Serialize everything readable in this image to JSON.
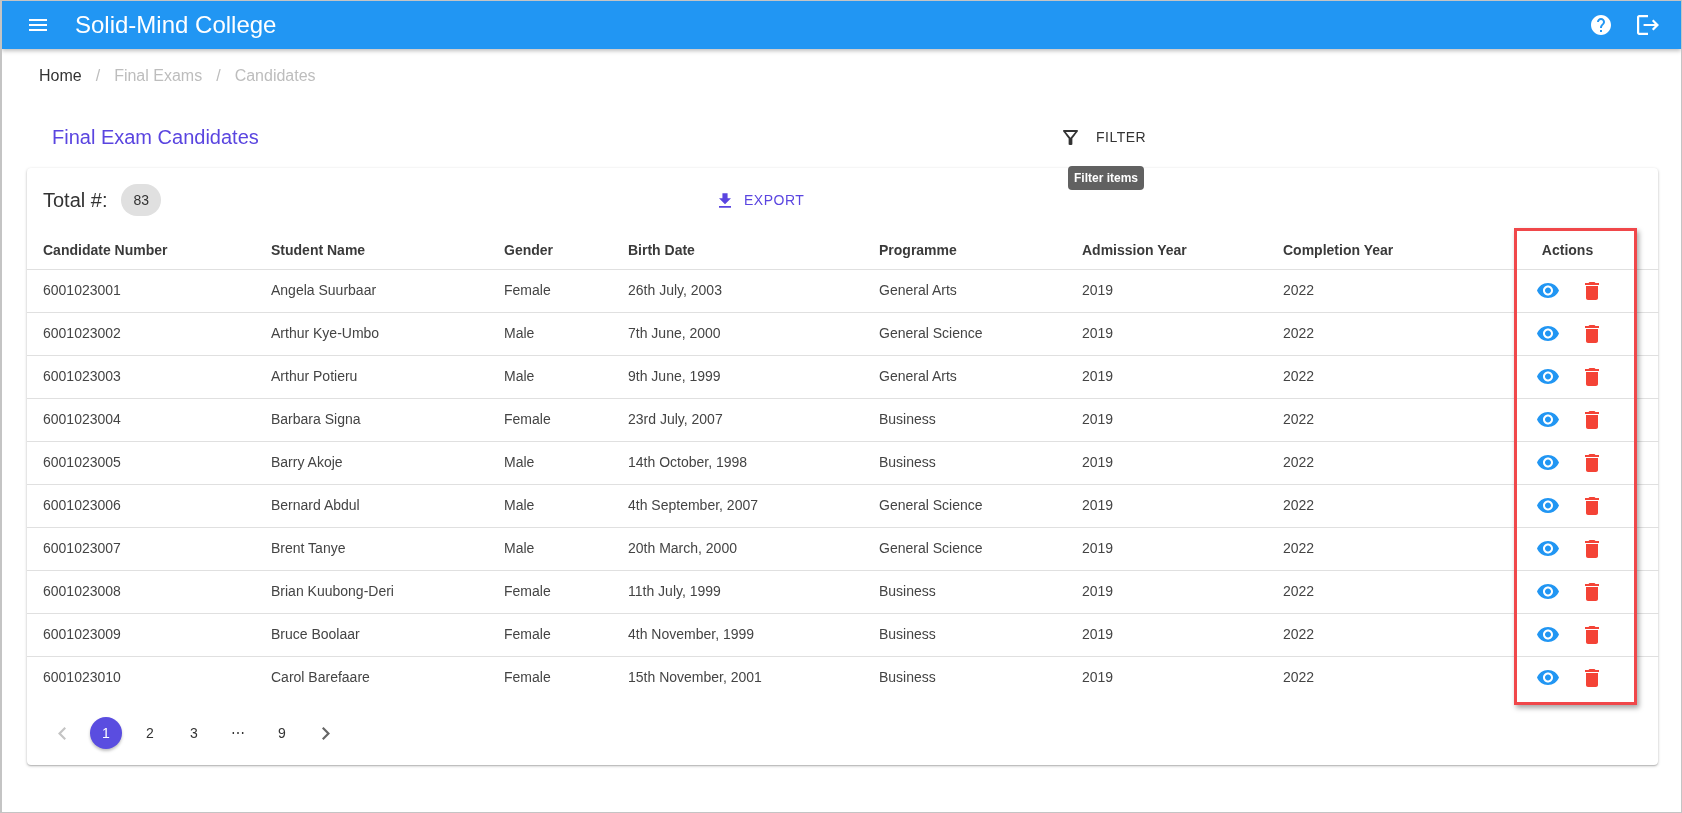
{
  "app_bar": {
    "title": "Solid-Mind College"
  },
  "breadcrumb": {
    "items": [
      {
        "label": "Home",
        "disabled": false
      },
      {
        "separator": "/",
        "label": "Final Exams",
        "disabled": true
      },
      {
        "separator": "/",
        "label": "Candidates",
        "disabled": true
      }
    ]
  },
  "page_title": "Final Exam Candidates",
  "filter_button": {
    "label": "FILTER",
    "tooltip": "Filter items"
  },
  "summary": {
    "label": "Total #:",
    "count": "83"
  },
  "export_button": {
    "label": "EXPORT"
  },
  "table": {
    "columns": [
      {
        "label": "Candidate Number",
        "kind": "text",
        "highlighted": false
      },
      {
        "label": "Student Name",
        "kind": "text",
        "highlighted": false
      },
      {
        "label": "Gender",
        "kind": "text",
        "highlighted": false
      },
      {
        "label": "Birth Date",
        "kind": "text",
        "highlighted": false
      },
      {
        "label": "Programme",
        "kind": "text",
        "highlighted": false
      },
      {
        "label": "Admission Year",
        "kind": "text",
        "highlighted": false
      },
      {
        "label": "Completion Year",
        "kind": "text",
        "highlighted": false
      },
      {
        "label": "Actions",
        "kind": "actions",
        "highlighted": true
      }
    ],
    "rows": [
      {
        "cells": [
          "6001023001",
          "Angela Suurbaar",
          "Female",
          "26th July, 2003",
          "General Arts",
          "2019",
          "2022"
        ]
      },
      {
        "cells": [
          "6001023002",
          "Arthur Kye-Umbo",
          "Male",
          "7th June, 2000",
          "General Science",
          "2019",
          "2022"
        ]
      },
      {
        "cells": [
          "6001023003",
          "Arthur Potieru",
          "Male",
          "9th June, 1999",
          "General Arts",
          "2019",
          "2022"
        ]
      },
      {
        "cells": [
          "6001023004",
          "Barbara Signa",
          "Female",
          "23rd July, 2007",
          "Business",
          "2019",
          "2022"
        ]
      },
      {
        "cells": [
          "6001023005",
          "Barry Akoje",
          "Male",
          "14th October, 1998",
          "Business",
          "2019",
          "2022"
        ]
      },
      {
        "cells": [
          "6001023006",
          "Bernard Abdul",
          "Male",
          "4th September, 2007",
          "General Science",
          "2019",
          "2022"
        ]
      },
      {
        "cells": [
          "6001023007",
          "Brent Tanye",
          "Male",
          "20th March, 2000",
          "General Science",
          "2019",
          "2022"
        ]
      },
      {
        "cells": [
          "6001023008",
          "Brian Kuubong-Deri",
          "Female",
          "11th July, 1999",
          "Business",
          "2019",
          "2022"
        ]
      },
      {
        "cells": [
          "6001023009",
          "Bruce Boolaar",
          "Female",
          "4th November, 1999",
          "Business",
          "2019",
          "2022"
        ]
      },
      {
        "cells": [
          "6001023010",
          "Carol Barefaare",
          "Female",
          "15th November, 2001",
          "Business",
          "2019",
          "2022"
        ]
      }
    ]
  },
  "pagination": {
    "previous": {
      "disabled": true
    },
    "next": {
      "disabled": false
    },
    "items": [
      {
        "kind": "page",
        "label": "1",
        "selected": true
      },
      {
        "kind": "page",
        "label": "2",
        "selected": false
      },
      {
        "kind": "page",
        "label": "3",
        "selected": false
      },
      {
        "kind": "ellipsis",
        "label": "⋯",
        "selected": false
      },
      {
        "kind": "page",
        "label": "9",
        "selected": false
      }
    ]
  }
}
